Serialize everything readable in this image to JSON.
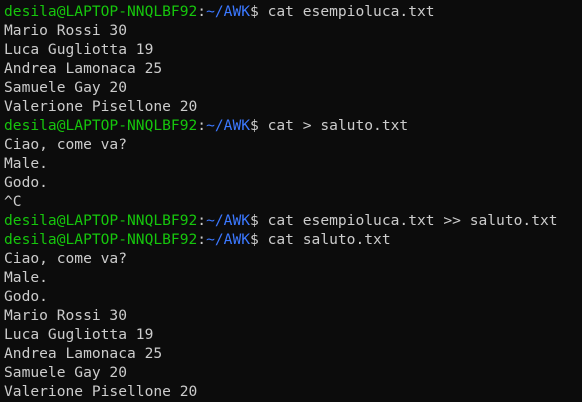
{
  "terminal": {
    "colors": {
      "background": "#0c0c0c",
      "text": "#cccccc",
      "user_host": "#16c60c",
      "path": "#3b78ff"
    },
    "lines": [
      {
        "type": "prompt",
        "user": "desila@LAPTOP-NNQLBF92",
        "sep": ":",
        "path": "~/AWK",
        "symbol": "$ ",
        "command": "cat esempioluca.txt"
      },
      {
        "type": "output",
        "text": "Mario Rossi 30"
      },
      {
        "type": "output",
        "text": "Luca Gugliotta 19"
      },
      {
        "type": "output",
        "text": "Andrea Lamonaca 25"
      },
      {
        "type": "output",
        "text": "Samuele Gay 20"
      },
      {
        "type": "output",
        "text": "Valerione Pisellone 20"
      },
      {
        "type": "prompt",
        "user": "desila@LAPTOP-NNQLBF92",
        "sep": ":",
        "path": "~/AWK",
        "symbol": "$ ",
        "command": "cat > saluto.txt"
      },
      {
        "type": "output",
        "text": "Ciao, come va?"
      },
      {
        "type": "output",
        "text": "Male."
      },
      {
        "type": "output",
        "text": "Godo."
      },
      {
        "type": "output",
        "text": "^C"
      },
      {
        "type": "prompt",
        "user": "desila@LAPTOP-NNQLBF92",
        "sep": ":",
        "path": "~/AWK",
        "symbol": "$ ",
        "command": "cat esempioluca.txt >> saluto.txt"
      },
      {
        "type": "prompt",
        "user": "desila@LAPTOP-NNQLBF92",
        "sep": ":",
        "path": "~/AWK",
        "symbol": "$ ",
        "command": "cat saluto.txt"
      },
      {
        "type": "output",
        "text": "Ciao, come va?"
      },
      {
        "type": "output",
        "text": "Male."
      },
      {
        "type": "output",
        "text": "Godo."
      },
      {
        "type": "output",
        "text": "Mario Rossi 30"
      },
      {
        "type": "output",
        "text": "Luca Gugliotta 19"
      },
      {
        "type": "output",
        "text": "Andrea Lamonaca 25"
      },
      {
        "type": "output",
        "text": "Samuele Gay 20"
      },
      {
        "type": "output",
        "text": "Valerione Pisellone 20"
      }
    ]
  }
}
